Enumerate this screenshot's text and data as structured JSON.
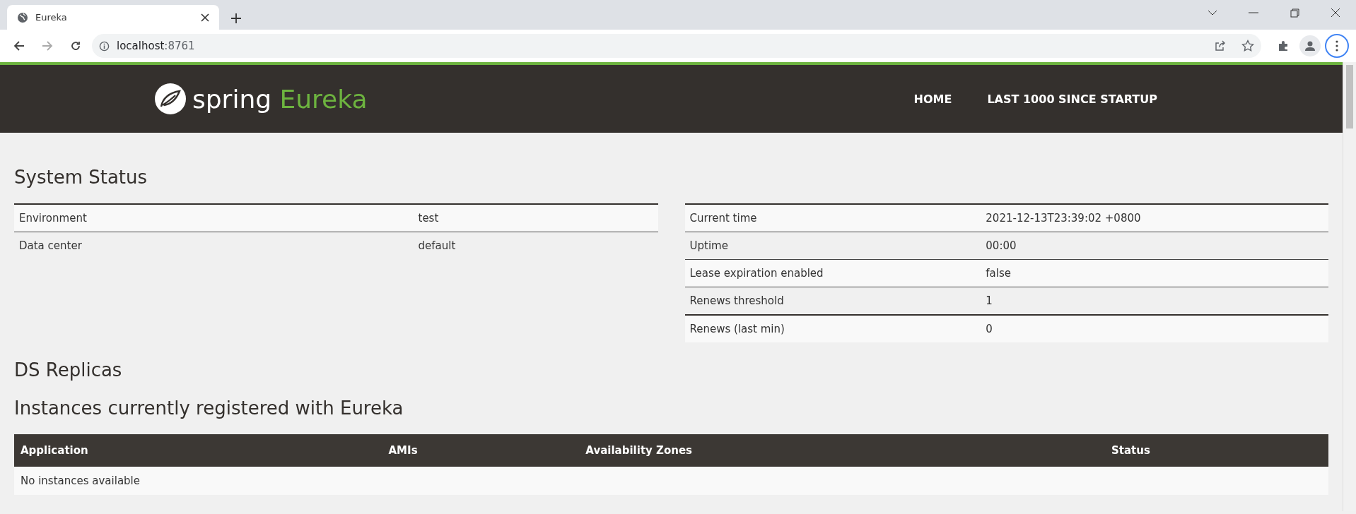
{
  "browser": {
    "tab_title": "Eureka",
    "url_host": "localhost",
    "url_port": ":8761"
  },
  "header": {
    "logo_word": "spring",
    "logo_product": "Eureka",
    "nav": [
      {
        "label": "HOME"
      },
      {
        "label": "LAST 1000 SINCE STARTUP"
      }
    ]
  },
  "system_status": {
    "title": "System Status",
    "left": [
      {
        "name": "Environment",
        "value": "test"
      },
      {
        "name": "Data center",
        "value": "default"
      }
    ],
    "right": [
      {
        "name": "Current time",
        "value": "2021-12-13T23:39:02 +0800"
      },
      {
        "name": "Uptime",
        "value": "00:00"
      },
      {
        "name": "Lease expiration enabled",
        "value": "false"
      },
      {
        "name": "Renews threshold",
        "value": "1"
      },
      {
        "name": "Renews (last min)",
        "value": "0"
      }
    ]
  },
  "ds_replicas": {
    "title": "DS Replicas"
  },
  "instances": {
    "title": "Instances currently registered with Eureka",
    "columns": [
      "Application",
      "AMIs",
      "Availability Zones",
      "Status"
    ],
    "empty": "No instances available"
  }
}
